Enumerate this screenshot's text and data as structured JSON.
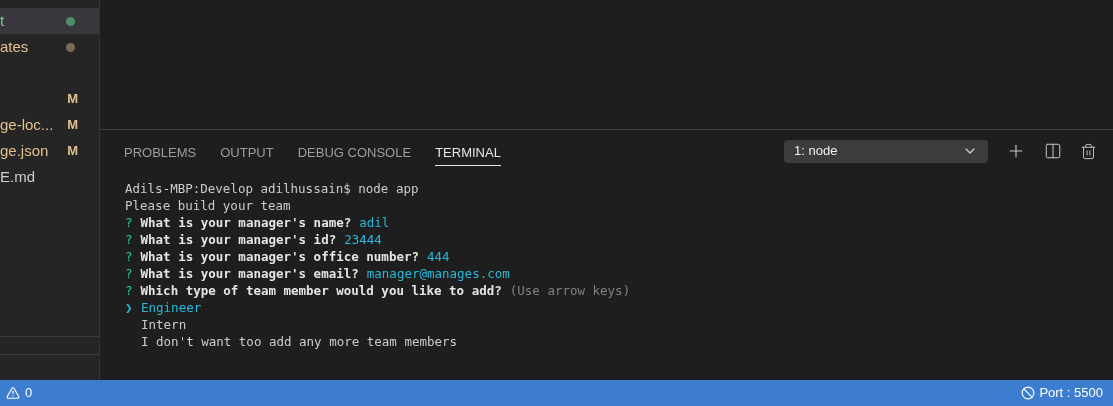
{
  "explorer": {
    "items": [
      {
        "kind": "dot",
        "name": "t",
        "selected": true,
        "untracked": true,
        "modified": false,
        "color": "#4e8f6a"
      },
      {
        "kind": "dot",
        "name": "ates",
        "selected": false,
        "untracked": false,
        "modified": true,
        "color": "#7b6a55"
      },
      {
        "kind": "spacer"
      },
      {
        "kind": "badge",
        "badge": "M",
        "selected": false
      },
      {
        "kind": "badge",
        "name": "ge-loc...",
        "badge": "M",
        "selected": false,
        "untracked": false,
        "modified": true
      },
      {
        "kind": "badge",
        "name": "ge.json",
        "badge": "M",
        "selected": false,
        "untracked": false,
        "modified": true
      },
      {
        "kind": "plain",
        "name": "E.md",
        "selected": false,
        "untracked": false,
        "modified": false
      }
    ]
  },
  "panel": {
    "tabs": [
      {
        "label": "PROBLEMS",
        "selected": false
      },
      {
        "label": "OUTPUT",
        "selected": false
      },
      {
        "label": "DEBUG CONSOLE",
        "selected": false
      },
      {
        "label": "TERMINAL",
        "selected": true
      }
    ],
    "terminal_select": {
      "value": "1: node"
    },
    "terminal_lines": [
      {
        "kind": "plain",
        "text": "Adils-MBP:Develop adilhussain$ node app"
      },
      {
        "kind": "plain",
        "text": "Please build your team"
      },
      {
        "kind": "question",
        "mark": "?",
        "question": "What is your manager's name?",
        "answer": "adil"
      },
      {
        "kind": "question",
        "mark": "?",
        "question": "What is your manager's id?",
        "answer": "23444"
      },
      {
        "kind": "question",
        "mark": "?",
        "question": "What is your manager's office number?",
        "answer": "444"
      },
      {
        "kind": "question",
        "mark": "?",
        "question": "What is your manager's email?",
        "answer": "manager@manages.com"
      },
      {
        "kind": "question",
        "mark": "?",
        "question": "Which type of team member would you like to add?",
        "hint": "(Use arrow keys)"
      },
      {
        "kind": "choice",
        "pointer": "❯",
        "text": "Engineer",
        "selected": true
      },
      {
        "kind": "choice",
        "text": "Intern",
        "selected": false
      },
      {
        "kind": "choice",
        "text": "I don't want too add any more team members",
        "selected": false
      }
    ]
  },
  "status_bar": {
    "warnings": "0",
    "port": "Port : 5500"
  }
}
